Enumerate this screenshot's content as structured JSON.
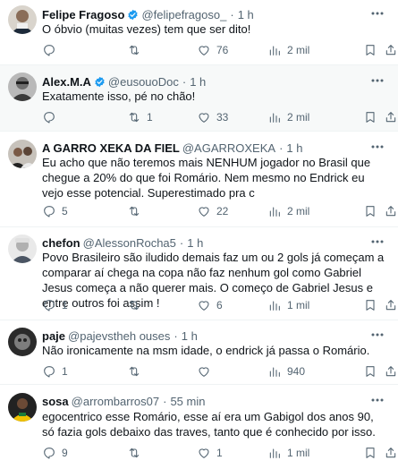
{
  "tweets": [
    {
      "name": "Felipe Fragoso",
      "verified": true,
      "handle": "@felipefragoso_",
      "time": "1 h",
      "text": "O óbvio (muitas vezes) tem que ser dito!",
      "replies": "",
      "retweets": "",
      "likes": "76",
      "views": "2 mil"
    },
    {
      "name": "Alex.M.A",
      "verified": true,
      "handle": "@eusouoDoc",
      "time": "1 h",
      "text": "Exatamente isso, pé no chão!",
      "replies": "",
      "retweets": "1",
      "likes": "33",
      "views": "2 mil"
    },
    {
      "name": "A GARRO XEKA DA FIEL",
      "verified": false,
      "handle": "@AGARROXEKA",
      "time": "1 h",
      "text": "Eu acho que não teremos mais NENHUM jogador no Brasil que chegue a 20% do que foi Romário. Nem mesmo no Endrick eu vejo esse potencial. Superestimado pra c",
      "replies": "5",
      "retweets": "",
      "likes": "22",
      "views": "2 mil"
    },
    {
      "name": "chefon",
      "verified": false,
      "handle": "@AlessonRocha5",
      "time": "1 h",
      "text": "Povo Brasileiro são iludido demais faz um ou 2 gols já começam a comparar aí chega na copa não faz nenhum gol como Gabriel Jesus começa a não querer mais. O começo de Gabriel Jesus e entre outros foi assim !",
      "replies": "1",
      "retweets": "",
      "likes": "6",
      "views": "1 mil"
    },
    {
      "name": "paje",
      "verified": false,
      "handle": "@pajevstheh ouses",
      "time": "1 h",
      "text": "Não ironicamente na msm idade, o endrick já passa o Romário.",
      "replies": "1",
      "retweets": "",
      "likes": "",
      "views": "940"
    },
    {
      "name": "sosa",
      "verified": false,
      "handle": "@arrombarros07",
      "time": "55 min",
      "text": "egocentrico esse Romário, esse aí era um Gabigol dos anos 90, só fazia gols debaixo das traves, tanto que é conhecido por isso.",
      "replies": "9",
      "retweets": "",
      "likes": "1",
      "views": "1 mil"
    }
  ],
  "colors": {
    "text": "#0f1419",
    "muted": "#536471",
    "verified": "#1d9bf0",
    "divider": "#eff3f4",
    "highlight_bg": "#f7f9f9"
  }
}
